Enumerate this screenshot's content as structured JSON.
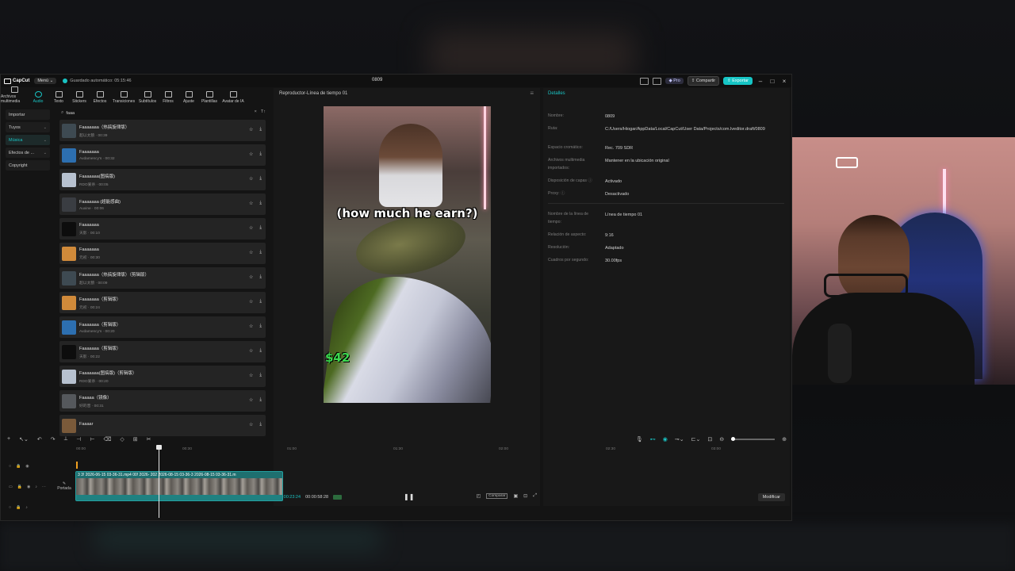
{
  "app": {
    "brand": "CapCut",
    "menu_label": "Menú",
    "autosave": "Guardado automático: 05:15:46",
    "project_title": "0809",
    "pro_label": "Pro",
    "share_label": "Compartir",
    "export_label": "Exportar",
    "accent_color": "#19c3c3"
  },
  "toolbar": {
    "items": [
      {
        "label": "Archivos multimedia",
        "icon": "media-icon"
      },
      {
        "label": "Audio",
        "icon": "audio-icon",
        "active": true
      },
      {
        "label": "Texto",
        "icon": "text-icon"
      },
      {
        "label": "Stickers",
        "icon": "sticker-icon"
      },
      {
        "label": "Efectos",
        "icon": "effects-icon"
      },
      {
        "label": "Transiciones",
        "icon": "transition-icon"
      },
      {
        "label": "Subtítulos",
        "icon": "subtitles-icon"
      },
      {
        "label": "Filtros",
        "icon": "filter-icon"
      },
      {
        "label": "Ajuste",
        "icon": "adjust-icon"
      },
      {
        "label": "Plantillas",
        "icon": "templates-icon"
      },
      {
        "label": "Avatar de IA",
        "icon": "avatar-icon"
      }
    ]
  },
  "categories": [
    {
      "label": "Importar",
      "chevron": false
    },
    {
      "label": "Tuyos",
      "chevron": true
    },
    {
      "label": "Música",
      "chevron": true,
      "active": true
    },
    {
      "label": "Efectos de ...",
      "chevron": true
    },
    {
      "label": "Copyright",
      "chevron": false
    }
  ],
  "search": {
    "value": "faaa",
    "filter_label": "T↑"
  },
  "tracks": [
    {
      "name": "Faaaaaaa（热搞旋律版）",
      "sub": "超以太狼 · 00:39",
      "thumb": "#3e4a52"
    },
    {
      "name": "Faaaaaaa",
      "sub": "Avdamency's · 00:32",
      "thumb": "#2d6fb0"
    },
    {
      "name": "Faaaaaaa(图搞版)",
      "sub": "RDO爱杀 · 00:05",
      "thumb": "#b7c1cf"
    },
    {
      "name": "Faaaaaaa (超能感曲)",
      "sub": "Auxine · 00:06",
      "thumb": "#3a3d42"
    },
    {
      "name": "Faaaaaaa",
      "sub": "天影 · 00:10",
      "thumb": "#0d0d0d"
    },
    {
      "name": "Faaaaaaa",
      "sub": "元初 · 00:30",
      "thumb": "#d08a3a"
    },
    {
      "name": "Faaaaaaa（热搞旋律版）（剪辑版）",
      "sub": "超以太狼 · 00:09",
      "thumb": "#3e4a52"
    },
    {
      "name": "Faaaaaaa（剪辑版）",
      "sub": "元初 · 00:24",
      "thumb": "#d08a3a"
    },
    {
      "name": "Faaaaaaa（剪辑版）",
      "sub": "Avdamency's · 00:20",
      "thumb": "#2d6fb0"
    },
    {
      "name": "Faaaaaaa（剪辑版）",
      "sub": "天影 · 00:22",
      "thumb": "#0d0d0d"
    },
    {
      "name": "Faaaaaaa(图搞版)（剪辑版）",
      "sub": "RDO爱杀 · 00:20",
      "thumb": "#b7c1cf"
    },
    {
      "name": "Faaaaa（镜像）",
      "sub": "好的音 · 00:31",
      "thumb": "#55585c"
    },
    {
      "name": "Faaaar",
      "sub": "",
      "thumb": "#7a5a3a"
    }
  ],
  "player": {
    "title": "Reproductor-Línea de tiempo 01",
    "caption": "(how much he earn?)",
    "money": "$42",
    "current_time": "00:00:23:24",
    "total_time": "00:00:58:28",
    "ratio_label": "Comparar"
  },
  "details": {
    "title": "Detalles",
    "rows": [
      {
        "label": "Nombre:",
        "value": "0809"
      },
      {
        "label": "Ruta:",
        "value": "C:/Users/Hiogar/AppData/Local/CapCut/User Data/Projects/com.lveditor.draft/0809"
      },
      {
        "label": "Espacio cromático:",
        "value": "Rec. 709 SDR"
      },
      {
        "label": "Archivos multimedia importados:",
        "value": "Mantener en la ubicación original"
      },
      {
        "label": "Disposición de capas ⓘ",
        "value": "Activado"
      },
      {
        "label": "Proxy: ⓘ",
        "value": "Desactivado"
      },
      {
        "label": "Nombre de la línea de tiempo:",
        "value": "Línea de tiempo 01"
      },
      {
        "label": "Relación de aspecto:",
        "value": "9:16"
      },
      {
        "label": "Resolución:",
        "value": "Adaptado"
      },
      {
        "label": "Cuadros por segundo:",
        "value": "30.00fps"
      }
    ],
    "modify_label": "Modificar"
  },
  "timeline": {
    "ruler": [
      "00:00",
      "00:30",
      "01:00",
      "01:30",
      "02:00",
      "02:30",
      "03:00"
    ],
    "clip_label": "3  3!  2026-06-15 03-36-31.mp4  00!  2026-  202  2026-08-15 03-36-3  2026-08-15 03-36-31.m",
    "cover_label": "Portada"
  }
}
